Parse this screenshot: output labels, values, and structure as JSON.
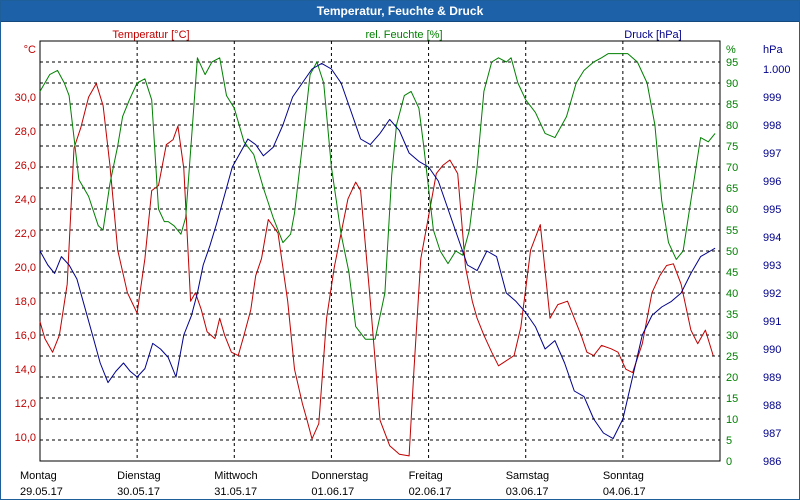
{
  "window": {
    "title": "Temperatur, Feuchte & Druck"
  },
  "colors": {
    "temperature": "#c00000",
    "humidity": "#008000",
    "pressure": "#00008b",
    "grid": "#000000",
    "titlebar": "#1d62a8"
  },
  "chart_data": {
    "type": "line",
    "title": "Temperatur, Feuchte & Druck",
    "grid": true,
    "xlim": [
      0,
      7
    ],
    "x_ticks": [
      {
        "day": "Montag",
        "date": "29.05.17"
      },
      {
        "day": "Dienstag",
        "date": "30.05.17"
      },
      {
        "day": "Mittwoch",
        "date": "31.05.17"
      },
      {
        "day": "Donnerstag",
        "date": "01.06.17"
      },
      {
        "day": "Freitag",
        "date": "02.06.17"
      },
      {
        "day": "Samstag",
        "date": "03.06.17"
      },
      {
        "day": "Sonntag",
        "date": "04.06.17"
      }
    ],
    "axes": {
      "left": {
        "unit": "°C",
        "min": 8.6,
        "max": 33.3,
        "ticks": [
          "10,0",
          "12,0",
          "14,0",
          "16,0",
          "18,0",
          "20,0",
          "22,0",
          "24,0",
          "26,0",
          "28,0",
          "30,0"
        ],
        "tick_values": [
          10,
          12,
          14,
          16,
          18,
          20,
          22,
          24,
          26,
          28,
          30
        ]
      },
      "middle": {
        "unit": "%",
        "min": 0,
        "max": 100,
        "ticks": [
          "0",
          "5",
          "10",
          "15",
          "20",
          "25",
          "30",
          "35",
          "40",
          "45",
          "50",
          "55",
          "60",
          "65",
          "70",
          "75",
          "80",
          "85",
          "90",
          "95"
        ],
        "tick_values": [
          0,
          5,
          10,
          15,
          20,
          25,
          30,
          35,
          40,
          45,
          50,
          55,
          60,
          65,
          70,
          75,
          80,
          85,
          90,
          95
        ]
      },
      "right": {
        "unit": "hPa",
        "min": 986,
        "max": 1001,
        "ticks": [
          "986",
          "987",
          "988",
          "989",
          "990",
          "991",
          "992",
          "993",
          "994",
          "995",
          "996",
          "997",
          "998",
          "999",
          "1.000"
        ],
        "tick_values": [
          986,
          987,
          988,
          989,
          990,
          991,
          992,
          993,
          994,
          995,
          996,
          997,
          998,
          999,
          1000
        ]
      }
    },
    "series": [
      {
        "name": "Temperatur [°C]",
        "axis": "left",
        "color": "#c00000",
        "x": [
          0,
          0.05,
          0.13,
          0.2,
          0.28,
          0.35,
          0.42,
          0.5,
          0.58,
          0.65,
          0.72,
          0.8,
          0.9,
          1.0,
          1.08,
          1.15,
          1.22,
          1.3,
          1.37,
          1.42,
          1.48,
          1.55,
          1.6,
          1.66,
          1.72,
          1.8,
          1.85,
          1.9,
          1.97,
          2.04,
          2.1,
          2.17,
          2.22,
          2.28,
          2.35,
          2.45,
          2.55,
          2.62,
          2.7,
          2.75,
          2.8,
          2.87,
          2.95,
          3.03,
          3.1,
          3.17,
          3.25,
          3.3,
          3.4,
          3.5,
          3.6,
          3.7,
          3.8,
          3.85,
          3.92,
          4.0,
          4.08,
          4.15,
          4.22,
          4.3,
          4.38,
          4.45,
          4.5,
          4.57,
          4.65,
          4.72,
          4.8,
          4.88,
          4.95,
          5.05,
          5.15,
          5.25,
          5.33,
          5.43,
          5.5,
          5.57,
          5.63,
          5.7,
          5.78,
          5.88,
          5.95,
          6.03,
          6.1,
          6.2,
          6.3,
          6.38,
          6.45,
          6.52,
          6.6,
          6.7,
          6.77,
          6.85,
          6.93
        ],
        "values": [
          16.8,
          15.8,
          15.0,
          16.0,
          19.0,
          27.0,
          28.2,
          30.0,
          30.8,
          29.5,
          26.0,
          21.0,
          18.5,
          17.3,
          20.5,
          24.5,
          24.8,
          27.2,
          27.5,
          28.3,
          25.8,
          18.0,
          18.5,
          17.5,
          16.2,
          15.8,
          17.0,
          16.0,
          15.0,
          14.8,
          16.0,
          17.5,
          19.5,
          20.5,
          22.8,
          22.0,
          18.0,
          14.0,
          12.0,
          11.0,
          9.9,
          10.8,
          17.0,
          20.0,
          22.0,
          24.0,
          25.0,
          24.5,
          18.0,
          11.0,
          9.5,
          9.0,
          8.9,
          14.0,
          20.5,
          23.0,
          25.5,
          26.0,
          26.3,
          25.5,
          20.0,
          18.0,
          17.0,
          16.0,
          15.0,
          14.2,
          14.5,
          14.8,
          16.5,
          21.0,
          22.5,
          17.0,
          17.8,
          18.0,
          17.0,
          16.0,
          15.0,
          14.8,
          15.4,
          15.2,
          15.0,
          14.0,
          13.8,
          15.5,
          18.5,
          19.5,
          20.1,
          20.2,
          19.0,
          16.3,
          15.5,
          16.3,
          14.8
        ]
      },
      {
        "name": "rel. Feuchte [%]",
        "axis": "middle",
        "color": "#008000",
        "x": [
          0,
          0.1,
          0.18,
          0.25,
          0.3,
          0.4,
          0.5,
          0.6,
          0.65,
          0.72,
          0.8,
          0.85,
          0.92,
          1.0,
          1.08,
          1.15,
          1.22,
          1.28,
          1.32,
          1.38,
          1.45,
          1.5,
          1.57,
          1.62,
          1.7,
          1.77,
          1.85,
          1.92,
          2.0,
          2.1,
          2.2,
          2.3,
          2.4,
          2.5,
          2.58,
          2.62,
          2.7,
          2.78,
          2.85,
          2.92,
          3.0,
          3.05,
          3.1,
          3.18,
          3.25,
          3.35,
          3.45,
          3.55,
          3.62,
          3.67,
          3.75,
          3.82,
          3.9,
          3.95,
          4.05,
          4.12,
          4.2,
          4.28,
          4.35,
          4.42,
          4.5,
          4.57,
          4.65,
          4.72,
          4.8,
          4.85,
          4.92,
          5.0,
          5.1,
          5.2,
          5.3,
          5.42,
          5.52,
          5.6,
          5.7,
          5.78,
          5.85,
          5.95,
          6.05,
          6.15,
          6.25,
          6.33,
          6.4,
          6.47,
          6.55,
          6.62,
          6.7,
          6.8,
          6.88,
          6.95
        ],
        "values": [
          88,
          92,
          93,
          90,
          87,
          67,
          63,
          56,
          55,
          66,
          75,
          82,
          86,
          90,
          91,
          86,
          60,
          57,
          57,
          56,
          54,
          58,
          80,
          96,
          92,
          95,
          96,
          87,
          84,
          76,
          73,
          65,
          58,
          52,
          54,
          59,
          75,
          92,
          95,
          90,
          70,
          62,
          54,
          45,
          32,
          29,
          29,
          40,
          68,
          80,
          87,
          88,
          84,
          75,
          55,
          50,
          47,
          50,
          49,
          55,
          70,
          88,
          95,
          96,
          95,
          96,
          90,
          86,
          83,
          78,
          77,
          82,
          90,
          93,
          95,
          96,
          97,
          97,
          97,
          95,
          90,
          80,
          62,
          52,
          48,
          50,
          62,
          77,
          76,
          78
        ]
      },
      {
        "name": "Druck [hPa]",
        "axis": "right",
        "color": "#00008b",
        "x": [
          0,
          0.08,
          0.15,
          0.22,
          0.3,
          0.38,
          0.46,
          0.54,
          0.62,
          0.7,
          0.78,
          0.86,
          0.93,
          1.0,
          1.08,
          1.16,
          1.24,
          1.32,
          1.4,
          1.48,
          1.56,
          1.62,
          1.68,
          1.75,
          1.82,
          1.9,
          1.98,
          2.06,
          2.14,
          2.22,
          2.3,
          2.4,
          2.5,
          2.6,
          2.7,
          2.8,
          2.9,
          3.0,
          3.1,
          3.2,
          3.3,
          3.4,
          3.5,
          3.6,
          3.7,
          3.8,
          3.9,
          4.0,
          4.1,
          4.2,
          4.3,
          4.4,
          4.5,
          4.6,
          4.7,
          4.8,
          4.9,
          5.0,
          5.1,
          5.2,
          5.3,
          5.4,
          5.5,
          5.6,
          5.7,
          5.8,
          5.9,
          6.0,
          6.1,
          6.2,
          6.3,
          6.4,
          6.5,
          6.6,
          6.7,
          6.8,
          6.9,
          6.95
        ],
        "values": [
          993.5,
          993.0,
          992.7,
          993.3,
          993.0,
          992.5,
          991.5,
          990.5,
          989.5,
          988.8,
          989.2,
          989.5,
          989.2,
          989.0,
          989.3,
          990.2,
          990.0,
          989.7,
          989.0,
          990.5,
          991.2,
          992.0,
          993.0,
          993.7,
          994.5,
          995.5,
          996.5,
          997.0,
          997.5,
          997.3,
          996.9,
          997.2,
          998.0,
          999.0,
          999.5,
          1000.0,
          1000.2,
          1000.0,
          999.5,
          998.5,
          997.5,
          997.3,
          997.7,
          998.2,
          997.8,
          997.0,
          996.7,
          996.5,
          996.0,
          995.0,
          994.0,
          993.0,
          992.8,
          993.5,
          993.3,
          992.0,
          991.7,
          991.3,
          990.8,
          990.0,
          990.3,
          989.5,
          988.5,
          988.3,
          987.5,
          987.0,
          986.8,
          987.5,
          989.0,
          990.5,
          991.2,
          991.5,
          991.7,
          992.0,
          992.7,
          993.3,
          993.5,
          993.6
        ]
      }
    ]
  }
}
